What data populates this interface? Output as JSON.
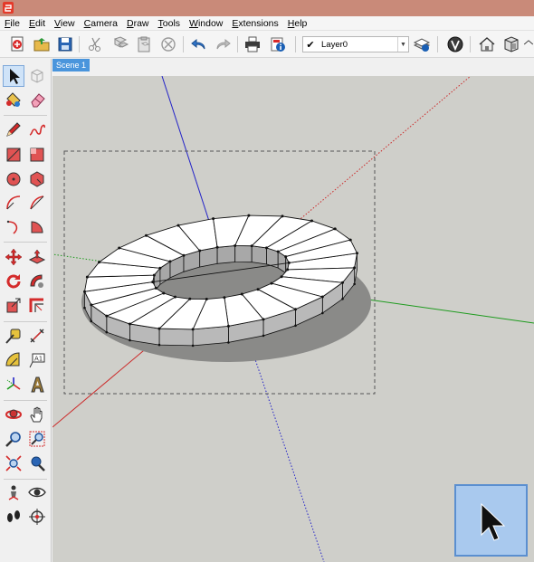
{
  "menus": [
    {
      "first": "F",
      "rest": "ile"
    },
    {
      "first": "E",
      "rest": "dit"
    },
    {
      "first": "V",
      "rest": "iew"
    },
    {
      "first": "C",
      "rest": "amera"
    },
    {
      "first": "D",
      "rest": "raw"
    },
    {
      "first": "T",
      "rest": "ools"
    },
    {
      "first": "W",
      "rest": "indow"
    },
    {
      "first": "E",
      "rest": "xtensions"
    },
    {
      "first": "H",
      "rest": "elp"
    }
  ],
  "layer": {
    "check": "✔",
    "name": "Layer0"
  },
  "scene": {
    "tab_label": "Scene 1"
  },
  "colors": {
    "titlebar": "#c98a79",
    "axis_red": "#cc2a2a",
    "axis_green": "#1e9b1e",
    "axis_blue": "#2323c8",
    "viewport_bg": "#cfcfca",
    "scene_tab": "#4a95dc"
  }
}
